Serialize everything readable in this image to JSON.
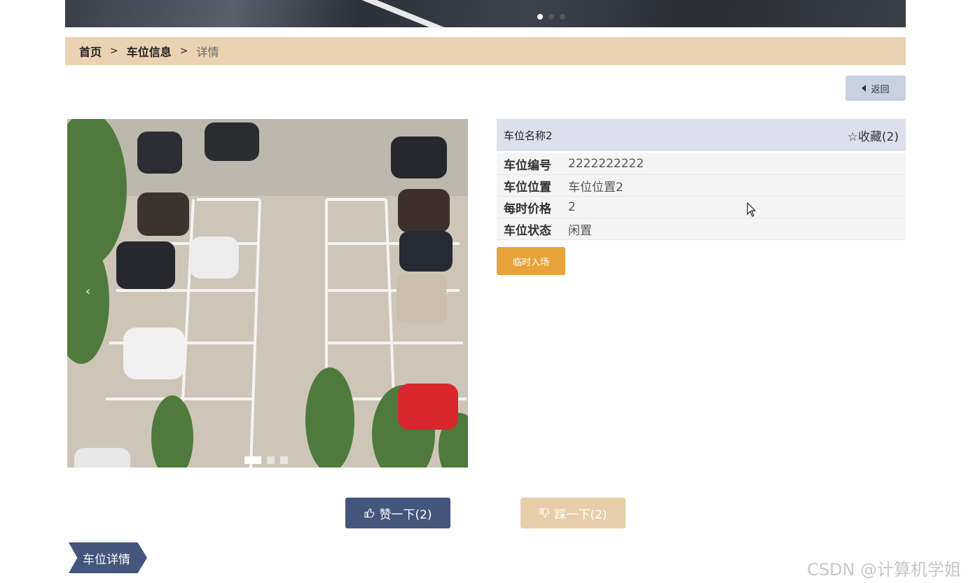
{
  "breadcrumb": {
    "home": "首页",
    "section": "车位信息",
    "current": "详情",
    "separator": ">"
  },
  "back_button": {
    "label": "返回",
    "icon": "caret-left-icon"
  },
  "carousel": {
    "prev_icon": "‹",
    "next_icon": "›",
    "slides": 3,
    "active_slide": 1
  },
  "banner": {
    "slides": 3,
    "active_slide": 1
  },
  "detail": {
    "name": "车位名称2",
    "favorite_label": "☆收藏(2)",
    "fields": [
      {
        "key": "车位编号",
        "value": "2222222222"
      },
      {
        "key": "车位位置",
        "value": "车位位置2"
      },
      {
        "key": "每时价格",
        "value": "2"
      },
      {
        "key": "车位状态",
        "value": "闲置"
      }
    ],
    "enter_button": "临时入场"
  },
  "votes": {
    "like_label": "赞一下(2)",
    "dislike_label": "踩一下(2)"
  },
  "section_tag": "车位详情",
  "watermark": "CSDN @计算机学姐",
  "colors": {
    "breadcrumb_bg": "#e9d3b1",
    "primary": "#45557d",
    "accent_orange": "#e8a43a",
    "dislike_bg": "#e6cfa8",
    "title_bar_bg": "#dde0ea"
  }
}
